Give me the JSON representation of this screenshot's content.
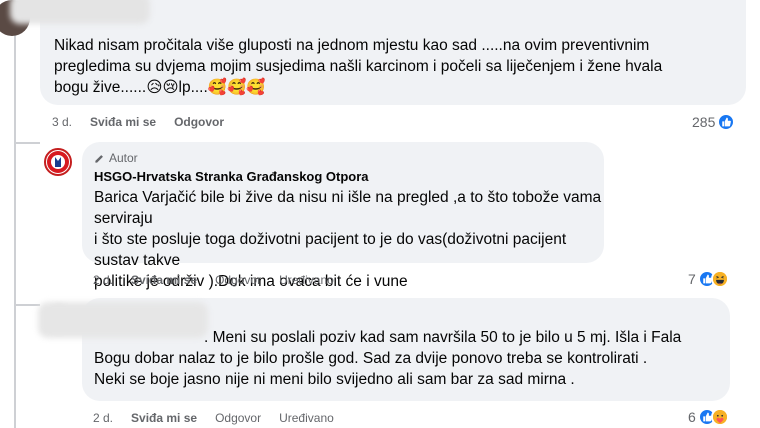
{
  "comments": [
    {
      "text": "Nikad nisam pročitala više gluposti na jednom mjestu kao sad .....na ovim preventivnim pregledima su dvjema mojim susjedima našli karcinom i počeli sa liječenjem i žene hvala bogu žive......😥😢lp....🥰🥰🥰",
      "line1": "Nikad nisam pročitala više gluposti na jednom mjestu kao sad .....na ovim preventivnim",
      "line2": "pregledima su dvjema mojim susjedima našli karcinom i počeli sa liječenjem i žene hvala",
      "line3": "bogu žive......😥😢lp....🥰🥰🥰",
      "time": "3 d.",
      "like": "Sviđa mi se",
      "reply": "Odgovor",
      "reactions": "285",
      "reaction_icons": [
        "like-icon"
      ]
    },
    {
      "badge": "Autor",
      "author": "HSGO-Hrvatska Stranka Građanskog Otpora",
      "line1": "Barica Varjačić bile bi žive da nisu ni išle na pregled ,a to što tobože vama serviraju",
      "line2": "i što ste posluje toga doživotni pacijent to je do vas(doživotni pacijent sustav takve",
      "line3": "politike je održiv ).Dok ima ovaca bit će i vune",
      "time": "2 d.",
      "like": "Sviđa mi se",
      "reply": "Odgovor",
      "edited": "Uređivano",
      "reactions": "7",
      "reaction_icons": [
        "like-icon",
        "haha-icon"
      ]
    },
    {
      "line1": ". Meni su poslali poziv kad sam navršila 50 to je bilo u 5 mj. Išla i Fala",
      "line2": "Bogu dobar nalaz to je bilo prošle god. Sad za dvije ponovo treba se kontrolirati .",
      "line3": "Neki se boje jasno nije ni meni bilo svijedno ali sam bar za sad mirna .",
      "time": "2 d.",
      "like": "Sviđa mi se",
      "reply": "Odgovor",
      "edited": "Uređivano",
      "reactions": "6",
      "reaction_icons": [
        "like-icon",
        "care-icon"
      ]
    }
  ]
}
